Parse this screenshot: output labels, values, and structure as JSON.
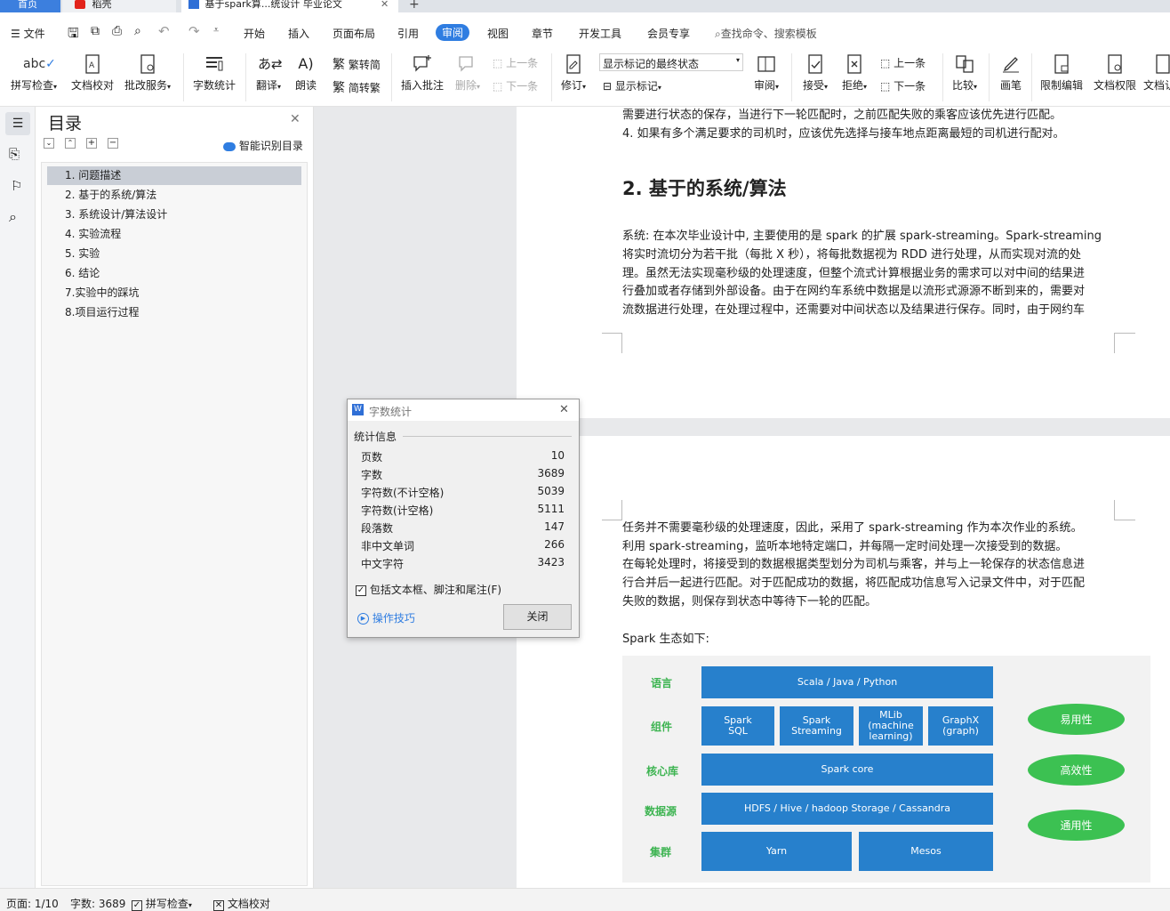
{
  "tabs": [
    {
      "label": "首页"
    },
    {
      "label": "稻壳"
    },
    {
      "label": "基于spark算...统设计 毕业论文"
    }
  ],
  "menu": {
    "file": "文件",
    "items": [
      "开始",
      "插入",
      "页面布局",
      "引用",
      "审阅",
      "视图",
      "章节",
      "开发工具",
      "会员专享"
    ],
    "active": "审阅",
    "search_placeholder": "查找命令、搜索模板"
  },
  "ribbon": {
    "spell_check": "拼写检查",
    "doc_proof": "文档校对",
    "batch_service": "批改服务",
    "word_count": "字数统计",
    "translate": "翻译",
    "read_aloud": "朗读",
    "trad_to_simp": "繁转简",
    "simp_to_trad": "简转繁",
    "insert_comment": "插入批注",
    "delete": "删除",
    "prev": "上一条",
    "next": "下一条",
    "revise": "修订",
    "markup_select": "显示标记的最终状态",
    "show_markup": "显示标记",
    "review": "审阅",
    "accept": "接受",
    "reject": "拒绝",
    "prev2": "上一条",
    "next2": "下一条",
    "compare": "比较",
    "pen": "画笔",
    "restrict_edit": "限制编辑",
    "doc_permission": "文档权限",
    "doc_more": "文档认"
  },
  "toc": {
    "title": "目录",
    "smart": "智能识别目录",
    "items": [
      "1.  问题描述",
      "2.  基于的系统/算法",
      "3.  系统设计/算法设计",
      "4.  实验流程",
      "5.  实验",
      "6.  结论",
      "7.实验中的踩坑",
      "8.项目运行过程"
    ]
  },
  "doc": {
    "p1_line1": "需要进行状态的保存，当进行下一轮匹配时，之前匹配失败的乘客应该优先进行匹配。",
    "p1_line2": "4.   如果有多个满足要求的司机时，应该优先选择与接车地点距离最短的司机进行配对。",
    "heading": "2.  基于的系统/算法",
    "p2": [
      "      系统: 在本次毕业设计中, 主要使用的是 spark 的扩展 spark-streaming。Spark-streaming",
      "将实时流切分为若干批（每批 X 秒），将每批数据视为 RDD 进行处理，从而实现对流的处",
      "理。虽然无法实现毫秒级的处理速度，但整个流式计算根据业务的需求可以对中间的结果进",
      "行叠加或者存储到外部设备。由于在网约车系统中数据是以流形式源源不断到来的，需要对",
      "流数据进行处理，在处理过程中，还需要对中间状态以及结果进行保存。同时，由于网约车"
    ],
    "p3": [
      "任务并不需要毫秒级的处理速度，因此，采用了 spark-streaming 作为本次作业的系统。",
      "      利用 spark-streaming，监听本地特定端口，并每隔一定时间处理一次接受到的数据。",
      "在每轮处理时，将接受到的数据根据类型划分为司机与乘客，并与上一轮保存的状态信息进",
      "行合并后一起进行匹配。对于匹配成功的数据，将匹配成功信息写入记录文件中，对于匹配",
      "失败的数据，则保存到状态中等待下一轮的匹配。"
    ],
    "spark_eco": "Spark 生态如下:"
  },
  "diagram": {
    "labels": [
      "语言",
      "组件",
      "核心库",
      "数据源",
      "集群"
    ],
    "lang": "Scala / Java / Python",
    "components": [
      "Spark SQL",
      "Spark Streaming",
      "MLib (machine learning)",
      "GraphX (graph)"
    ],
    "core": "Spark core",
    "datasource": "HDFS / Hive / hadoop Storage / Cassandra",
    "cluster": [
      "Yarn",
      "Mesos"
    ],
    "traits": [
      "易用性",
      "高效性",
      "通用性"
    ]
  },
  "dialog": {
    "title": "字数统计",
    "section": "统计信息",
    "rows": [
      {
        "label": "页数",
        "value": "10"
      },
      {
        "label": "字数",
        "value": "3689"
      },
      {
        "label": "字符数(不计空格)",
        "value": "5039"
      },
      {
        "label": "字符数(计空格)",
        "value": "5111"
      },
      {
        "label": "段落数",
        "value": "147"
      },
      {
        "label": "非中文单词",
        "value": "266"
      },
      {
        "label": "中文字符",
        "value": "3423"
      }
    ],
    "include_label": "包括文本框、脚注和尾注(F)",
    "tips": "操作技巧",
    "close": "关闭"
  },
  "status": {
    "page": "页面: 1/10",
    "words": "字数: 3689",
    "spell": "拼写检查",
    "proof": "文档校对"
  },
  "colors": {
    "accent": "#2f7de1",
    "block": "#2780cc",
    "green": "#3cc152"
  }
}
